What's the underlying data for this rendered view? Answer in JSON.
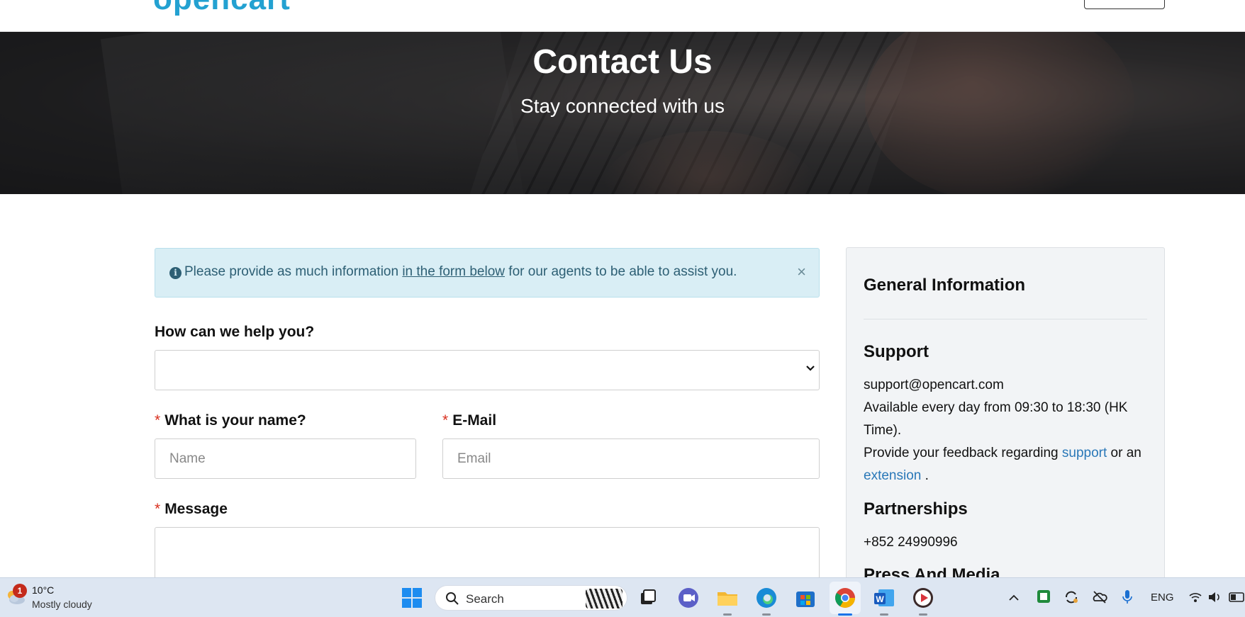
{
  "header": {
    "logo_text": "opencart",
    "hero_title": "Contact Us",
    "hero_subtitle": "Stay connected with us"
  },
  "alert": {
    "text_before": "Please provide as much information ",
    "link_text": "in the form below",
    "text_after": " for our agents to be able to assist you.",
    "close_label": "×"
  },
  "form": {
    "help_label": "How can we help you?",
    "help_selected": "",
    "name_label": "What is your name?",
    "name_placeholder": "Name",
    "name_value": "",
    "email_label": "E-Mail",
    "email_placeholder": "Email",
    "email_value": "",
    "message_label": "Message",
    "message_value": "",
    "required_mark": "*"
  },
  "sidebar": {
    "title": "General Information",
    "support_heading": "Support",
    "support_email": "support@opencart.com",
    "availability_line1": "Available every day from 09:30 to 18:30 (HK",
    "availability_line2": "Time).",
    "feedback_before": "Provide your feedback regarding ",
    "feedback_link1": "support",
    "feedback_middle": " or an",
    "feedback_link2": "extension",
    "feedback_after": " .",
    "partnerships_heading": "Partnerships",
    "partnerships_phone": "+852 24990996",
    "press_heading": "Press And Media"
  },
  "taskbar": {
    "weather_badge": "1",
    "temperature": "10°C",
    "condition": "Mostly cloudy",
    "search_label": "Search",
    "language": "ENG",
    "icons": [
      "start-icon",
      "task-view-icon",
      "meet-icon",
      "file-explorer-icon",
      "edge-icon",
      "store-icon",
      "chrome-icon",
      "word-icon",
      "media-player-icon"
    ],
    "tray_icons": [
      "chevron-up-icon",
      "green-app-icon",
      "sync-icon",
      "onedrive-icon",
      "microphone-icon",
      "wifi-icon",
      "volume-icon",
      "battery-icon"
    ]
  },
  "colors": {
    "brand": "#23a1d1",
    "link": "#2a78b8",
    "required": "#d9301f",
    "alert_bg": "#d9eef5",
    "alert_text": "#2d5f74",
    "panel_bg": "#f2f4f6"
  }
}
